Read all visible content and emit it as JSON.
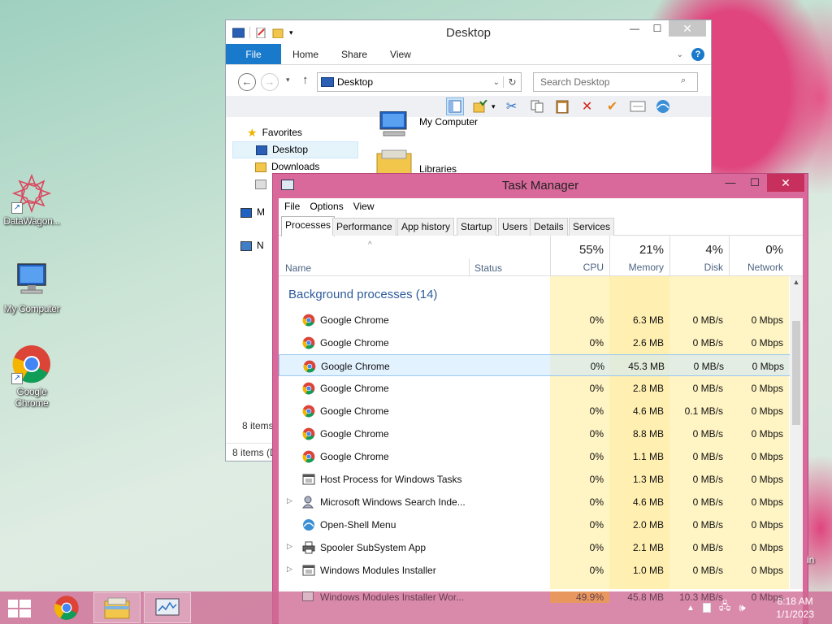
{
  "desktop": {
    "icons": [
      {
        "label": "DataWagon..."
      },
      {
        "label": "My Computer"
      },
      {
        "label": "Google Chrome"
      }
    ],
    "edge_text": "in"
  },
  "explorer": {
    "title": "Desktop",
    "ribbon_tabs": [
      "File",
      "Home",
      "Share",
      "View"
    ],
    "help": "?",
    "address": "Desktop",
    "search_placeholder": "Search Desktop",
    "nav": {
      "favorites": "Favorites",
      "desktop": "Desktop",
      "downloads": "Downloads",
      "m": "M",
      "n": "N"
    },
    "files": [
      {
        "label": "My Computer"
      },
      {
        "label": "Libraries"
      }
    ],
    "items_count": "8 items",
    "status": "8 items (D"
  },
  "taskmgr": {
    "title": "Task Manager",
    "menu": [
      "File",
      "Options",
      "View"
    ],
    "tabs": [
      "Processes",
      "Performance",
      "App history",
      "Startup",
      "Users",
      "Details",
      "Services"
    ],
    "columns": {
      "name": "Name",
      "status": "Status",
      "cpu": {
        "pct": "55%",
        "label": "CPU"
      },
      "memory": {
        "pct": "21%",
        "label": "Memory"
      },
      "disk": {
        "pct": "4%",
        "label": "Disk"
      },
      "network": {
        "pct": "0%",
        "label": "Network"
      }
    },
    "group_title": "Background processes (14)",
    "rows": [
      {
        "name": "Google Chrome",
        "icon": "chrome-icon",
        "cpu": "0%",
        "mem": "6.3 MB",
        "disk": "0 MB/s",
        "net": "0 Mbps",
        "expand": ""
      },
      {
        "name": "Google Chrome",
        "icon": "chrome-icon",
        "cpu": "0%",
        "mem": "2.6 MB",
        "disk": "0 MB/s",
        "net": "0 Mbps",
        "expand": ""
      },
      {
        "name": "Google Chrome",
        "icon": "chrome-icon",
        "cpu": "0%",
        "mem": "45.3 MB",
        "disk": "0 MB/s",
        "net": "0 Mbps",
        "expand": "",
        "selected": true
      },
      {
        "name": "Google Chrome",
        "icon": "chrome-icon",
        "cpu": "0%",
        "mem": "2.8 MB",
        "disk": "0 MB/s",
        "net": "0 Mbps",
        "expand": ""
      },
      {
        "name": "Google Chrome",
        "icon": "chrome-icon",
        "cpu": "0%",
        "mem": "4.6 MB",
        "disk": "0.1 MB/s",
        "net": "0 Mbps",
        "expand": ""
      },
      {
        "name": "Google Chrome",
        "icon": "chrome-icon",
        "cpu": "0%",
        "mem": "8.8 MB",
        "disk": "0 MB/s",
        "net": "0 Mbps",
        "expand": ""
      },
      {
        "name": "Google Chrome",
        "icon": "chrome-icon",
        "cpu": "0%",
        "mem": "1.1 MB",
        "disk": "0 MB/s",
        "net": "0 Mbps",
        "expand": ""
      },
      {
        "name": "Host Process for Windows Tasks",
        "icon": "window-icon",
        "cpu": "0%",
        "mem": "1.3 MB",
        "disk": "0 MB/s",
        "net": "0 Mbps",
        "expand": ""
      },
      {
        "name": "Microsoft Windows Search Inde...",
        "icon": "search-user-icon",
        "cpu": "0%",
        "mem": "4.6 MB",
        "disk": "0 MB/s",
        "net": "0 Mbps",
        "expand": "▷"
      },
      {
        "name": "Open-Shell Menu",
        "icon": "shell-icon",
        "cpu": "0%",
        "mem": "2.0 MB",
        "disk": "0 MB/s",
        "net": "0 Mbps",
        "expand": ""
      },
      {
        "name": "Spooler SubSystem App",
        "icon": "printer-icon",
        "cpu": "0%",
        "mem": "2.1 MB",
        "disk": "0 MB/s",
        "net": "0 Mbps",
        "expand": "▷"
      },
      {
        "name": "Windows Modules Installer",
        "icon": "window-icon",
        "cpu": "0%",
        "mem": "1.0 MB",
        "disk": "0 MB/s",
        "net": "0 Mbps",
        "expand": "▷"
      }
    ],
    "overflow_row": {
      "name": "Windows Modules Installer Wor...",
      "cpu": "49.9%",
      "mem": "45.8 MB",
      "disk": "10.3 MB/s",
      "net": "0 Mbps"
    }
  },
  "taskbar": {
    "clock_time": "8:18 AM",
    "clock_date": "1/1/2023"
  },
  "colors": {
    "accent_blue": "#1979ca",
    "heat_light": "#fff4c4",
    "heat_mid": "#ffe9a0",
    "heat_hot": "#f9a825",
    "taskmgr_frame": "#d9699b"
  }
}
